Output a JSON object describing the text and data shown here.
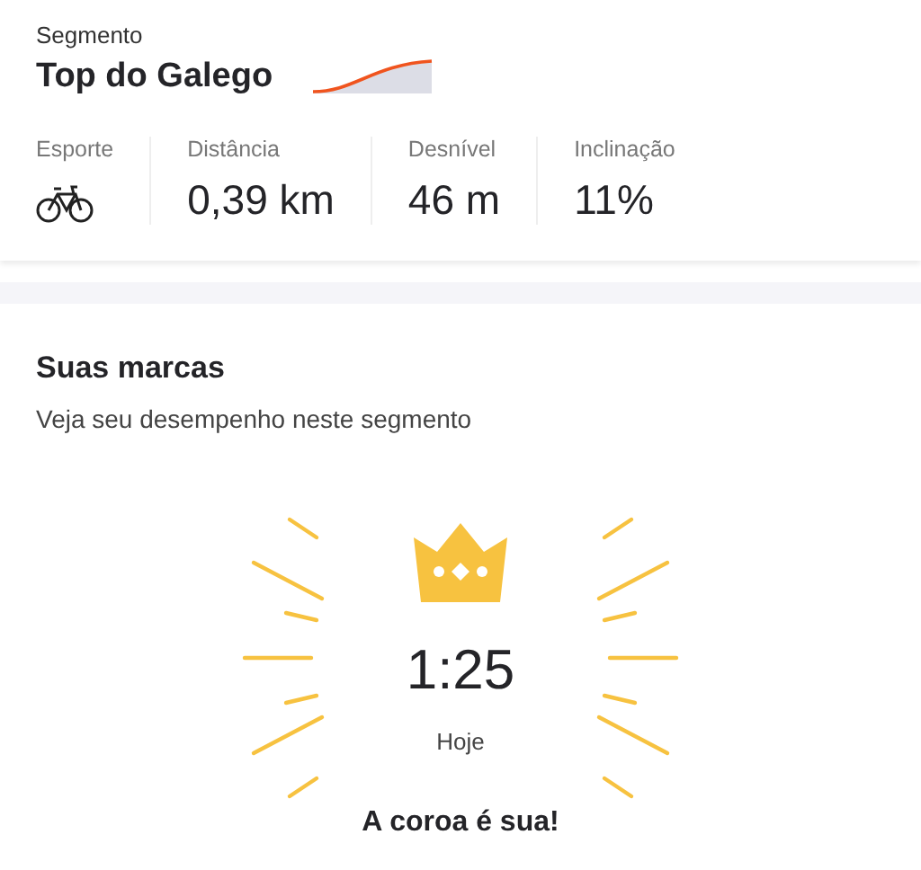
{
  "segment": {
    "label": "Segmento",
    "name": "Top do Galego"
  },
  "stats": [
    {
      "kind": "icon",
      "label": "Esporte"
    },
    {
      "kind": "value",
      "label": "Distância",
      "value": "0,39 km"
    },
    {
      "kind": "value",
      "label": "Desnível",
      "value": "46 m"
    },
    {
      "kind": "value",
      "label": "Inclinação",
      "value": "11%"
    }
  ],
  "marks": {
    "title": "Suas marcas",
    "subtitle": "Veja seu desempenho neste segmento",
    "time": "1:25",
    "date": "Hoje",
    "message": "A coroa é sua!"
  }
}
